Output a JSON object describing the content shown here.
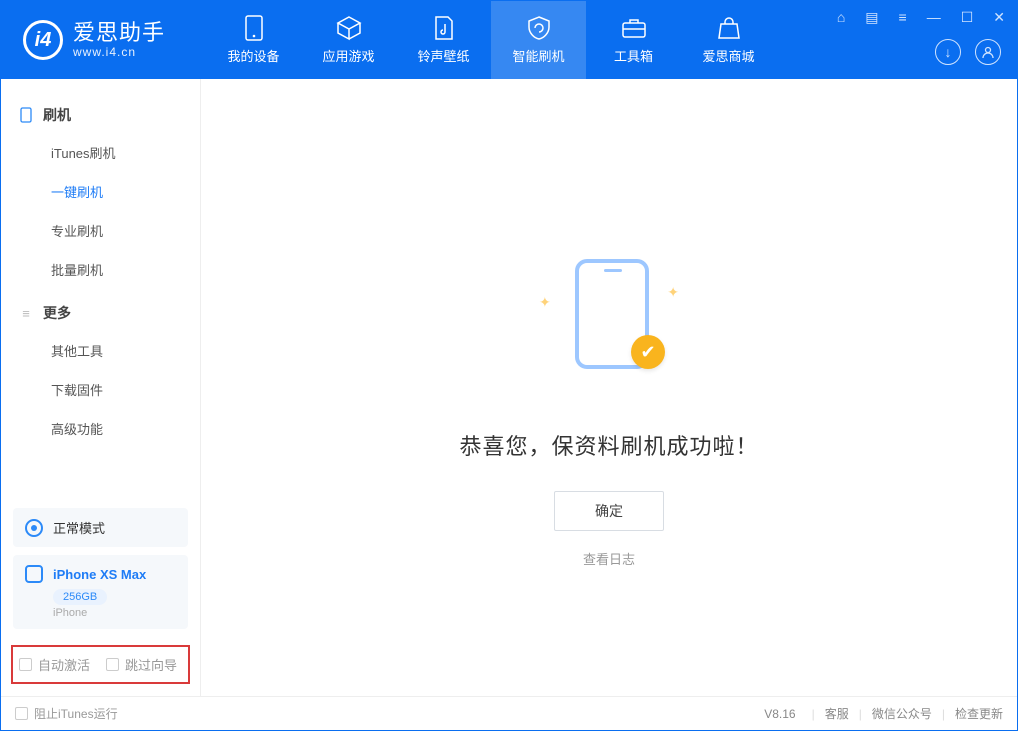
{
  "brand": {
    "name": "爱思助手",
    "url": "www.i4.cn"
  },
  "topTabs": {
    "device": "我的设备",
    "apps": "应用游戏",
    "ring": "铃声壁纸",
    "flash": "智能刷机",
    "toolbox": "工具箱",
    "store": "爱思商城"
  },
  "sidebar": {
    "group1": {
      "title": "刷机",
      "items": {
        "itunes": "iTunes刷机",
        "onekey": "一键刷机",
        "pro": "专业刷机",
        "batch": "批量刷机"
      }
    },
    "group2": {
      "title": "更多",
      "items": {
        "other": "其他工具",
        "firmware": "下载固件",
        "advanced": "高级功能"
      }
    }
  },
  "device": {
    "modeLabel": "正常模式",
    "name": "iPhone XS Max",
    "storage": "256GB",
    "sub": "iPhone"
  },
  "bottomChecks": {
    "auto": "自动激活",
    "skip": "跳过向导"
  },
  "main": {
    "successText": "恭喜您，保资料刷机成功啦！",
    "okBtn": "确定",
    "logLink": "查看日志"
  },
  "status": {
    "blockItunes": "阻止iTunes运行",
    "version": "V8.16",
    "links": {
      "support": "客服",
      "wechat": "微信公众号",
      "update": "检查更新"
    }
  }
}
